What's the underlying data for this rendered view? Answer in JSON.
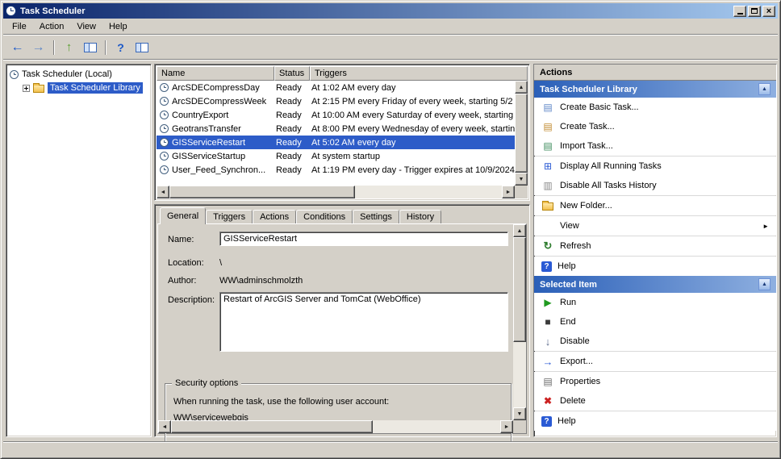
{
  "window": {
    "title": "Task Scheduler"
  },
  "menubar": {
    "items": [
      "File",
      "Action",
      "View",
      "Help"
    ]
  },
  "toolbar": {
    "icons": [
      "back",
      "forward",
      "export-list",
      "console-tree",
      "help",
      "action-pane"
    ]
  },
  "tree": {
    "root_label": "Task Scheduler (Local)",
    "library_label": "Task Scheduler Library"
  },
  "task_list": {
    "columns": [
      "Name",
      "Status",
      "Triggers"
    ],
    "rows": [
      {
        "name": "ArcSDECompressDay",
        "status": "Ready",
        "triggers": "At 1:02 AM every day"
      },
      {
        "name": "ArcSDECompressWeek",
        "status": "Ready",
        "triggers": "At 2:15 PM every Friday of every week, starting 5/2"
      },
      {
        "name": "CountryExport",
        "status": "Ready",
        "triggers": "At 10:00 AM every Saturday of every week, starting"
      },
      {
        "name": "GeotransTransfer",
        "status": "Ready",
        "triggers": "At 8:00 PM every Wednesday of every week, startin"
      },
      {
        "name": "GISServiceRestart",
        "status": "Ready",
        "triggers": "At 5:02 AM every day"
      },
      {
        "name": "GISServiceStartup",
        "status": "Ready",
        "triggers": "At system startup"
      },
      {
        "name": "User_Feed_Synchron...",
        "status": "Ready",
        "triggers": "At 1:19 PM every day - Trigger expires at 10/9/2024"
      }
    ],
    "selected_row": "GISServiceRestart"
  },
  "details": {
    "tabs": [
      "General",
      "Triggers",
      "Actions",
      "Conditions",
      "Settings",
      "History"
    ],
    "active_tab": "General",
    "general": {
      "name_label": "Name:",
      "name_value": "GISServiceRestart",
      "location_label": "Location:",
      "location_value": "\\",
      "author_label": "Author:",
      "author_value": "WW\\adminschmolzth",
      "description_label": "Description:",
      "description_value": "Restart of ArcGIS Server and TomCat (WebOffice)",
      "security_title": "Security options",
      "security_line1": "When running the task, use the following user account:",
      "security_line2": "WW\\servicewebgis"
    }
  },
  "actions_panel": {
    "title": "Actions",
    "sections": [
      {
        "header": "Task Scheduler Library",
        "items": [
          {
            "label": "Create Basic Task...",
            "icon": "create-basic-task-icon"
          },
          {
            "label": "Create Task...",
            "icon": "create-task-icon"
          },
          {
            "label": "Import Task...",
            "icon": "import-task-icon"
          },
          {
            "label": "Display All Running Tasks",
            "icon": "display-running-tasks-icon"
          },
          {
            "label": "Disable All Tasks History",
            "icon": "disable-tasks-history-icon"
          },
          {
            "label": "New Folder...",
            "icon": "new-folder-icon"
          },
          {
            "label": "View",
            "icon": "view-icon"
          },
          {
            "label": "Refresh",
            "icon": "refresh-icon"
          },
          {
            "label": "Help",
            "icon": "help-icon"
          }
        ]
      },
      {
        "header": "Selected Item",
        "items": [
          {
            "label": "Run",
            "icon": "run-icon"
          },
          {
            "label": "End",
            "icon": "end-icon"
          },
          {
            "label": "Disable",
            "icon": "disable-icon"
          },
          {
            "label": "Export...",
            "icon": "export-icon"
          },
          {
            "label": "Properties",
            "icon": "properties-icon"
          },
          {
            "label": "Delete",
            "icon": "delete-icon"
          },
          {
            "label": "Help",
            "icon": "help-icon"
          }
        ]
      }
    ]
  }
}
